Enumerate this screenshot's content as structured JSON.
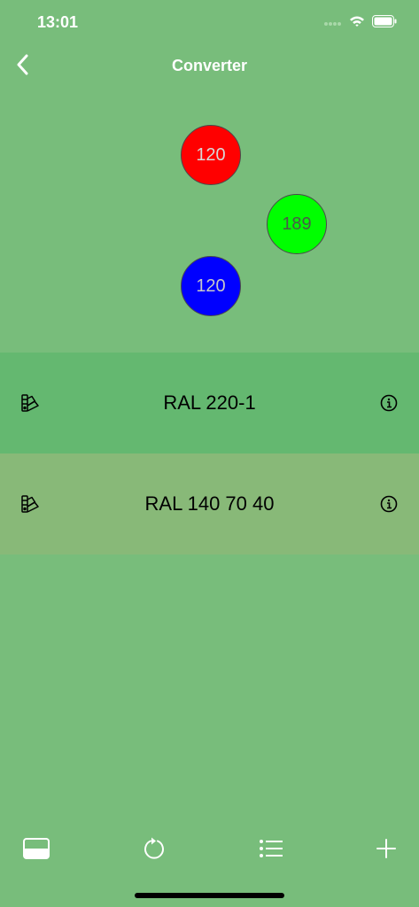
{
  "status_bar": {
    "time": "13:01"
  },
  "nav": {
    "title": "Converter"
  },
  "color_values": {
    "red": "120",
    "green": "189",
    "blue": "120"
  },
  "rows": [
    {
      "label": "RAL 220-1",
      "background": "#64b870"
    },
    {
      "label": "RAL 140 70 40",
      "background": "#88b978"
    }
  ],
  "colors": {
    "background": "#78bd7b",
    "red": "#ff0000",
    "green": "#00ff00",
    "blue": "#0000ff"
  },
  "toolbar": {
    "icons": [
      "color-swatch-icon",
      "refresh-icon",
      "list-icon",
      "plus-icon"
    ]
  }
}
